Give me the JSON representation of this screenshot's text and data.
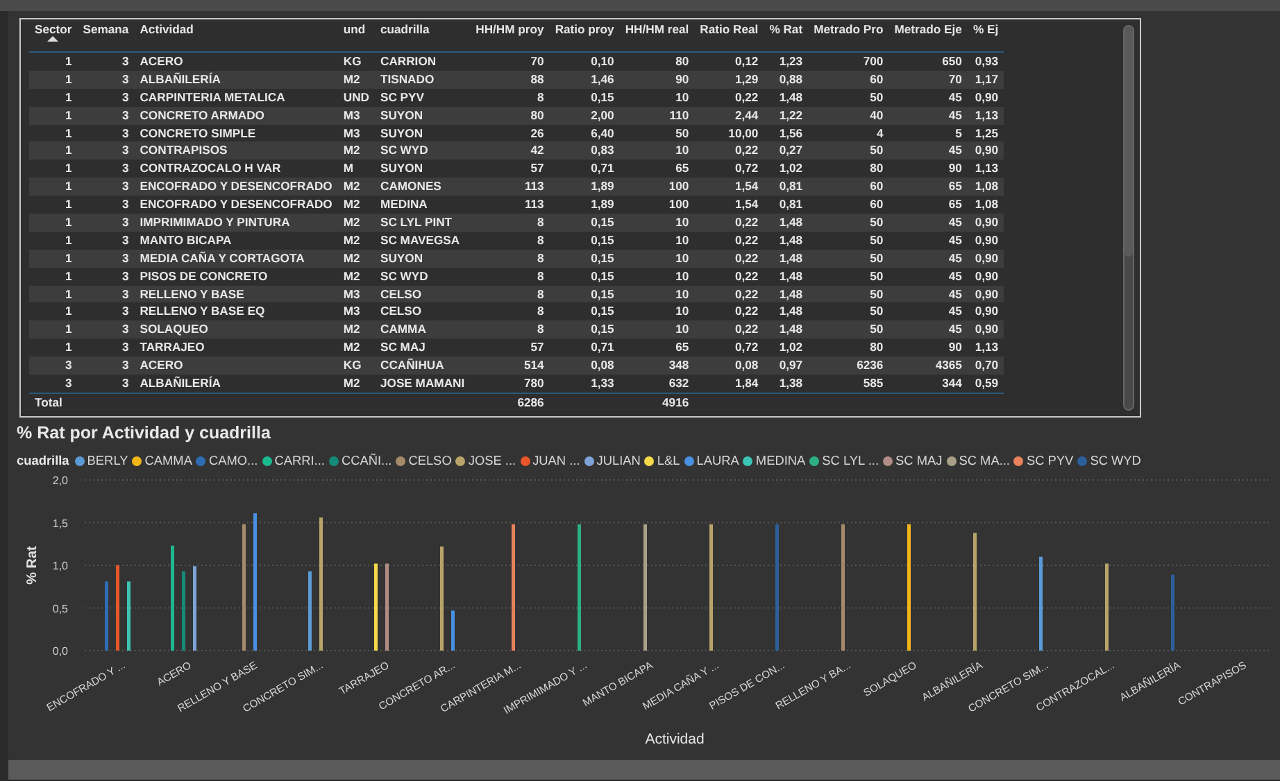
{
  "table": {
    "columns": [
      {
        "label": "Sector",
        "kind": "number",
        "sorted": true
      },
      {
        "label": "Semana",
        "kind": "number",
        "sorted": false
      },
      {
        "label": "Actividad",
        "kind": "text",
        "sorted": false
      },
      {
        "label": "und",
        "kind": "text",
        "sorted": false
      },
      {
        "label": "cuadrilla",
        "kind": "text",
        "sorted": false
      },
      {
        "label": "HH/HM proy",
        "kind": "number",
        "sorted": false
      },
      {
        "label": "Ratio proy",
        "kind": "number",
        "sorted": false
      },
      {
        "label": "HH/HM real",
        "kind": "number",
        "sorted": false
      },
      {
        "label": "Ratio Real",
        "kind": "number",
        "sorted": false
      },
      {
        "label": "% Rat",
        "kind": "number",
        "sorted": false
      },
      {
        "label": "Metrado Pro",
        "kind": "number",
        "sorted": false
      },
      {
        "label": "Metrado Eje",
        "kind": "number",
        "sorted": false
      },
      {
        "label": "% Ej",
        "kind": "number",
        "sorted": false
      }
    ],
    "rows": [
      [
        "1",
        "3",
        "ACERO",
        "KG",
        "CARRION",
        "70",
        "0,10",
        "80",
        "0,12",
        "1,23",
        "700",
        "650",
        "0,93"
      ],
      [
        "1",
        "3",
        "ALBAÑILERÍA",
        "M2",
        "TISNADO",
        "88",
        "1,46",
        "90",
        "1,29",
        "0,88",
        "60",
        "70",
        "1,17"
      ],
      [
        "1",
        "3",
        "CARPINTERIA METALICA",
        "UND",
        "SC PYV",
        "8",
        "0,15",
        "10",
        "0,22",
        "1,48",
        "50",
        "45",
        "0,90"
      ],
      [
        "1",
        "3",
        "CONCRETO ARMADO",
        "M3",
        "SUYON",
        "80",
        "2,00",
        "110",
        "2,44",
        "1,22",
        "40",
        "45",
        "1,13"
      ],
      [
        "1",
        "3",
        "CONCRETO SIMPLE",
        "M3",
        "SUYON",
        "26",
        "6,40",
        "50",
        "10,00",
        "1,56",
        "4",
        "5",
        "1,25"
      ],
      [
        "1",
        "3",
        "CONTRAPISOS",
        "M2",
        "SC WYD",
        "42",
        "0,83",
        "10",
        "0,22",
        "0,27",
        "50",
        "45",
        "0,90"
      ],
      [
        "1",
        "3",
        "CONTRAZOCALO H VAR",
        "M",
        "SUYON",
        "57",
        "0,71",
        "65",
        "0,72",
        "1,02",
        "80",
        "90",
        "1,13"
      ],
      [
        "1",
        "3",
        "ENCOFRADO Y DESENCOFRADO",
        "M2",
        "CAMONES",
        "113",
        "1,89",
        "100",
        "1,54",
        "0,81",
        "60",
        "65",
        "1,08"
      ],
      [
        "1",
        "3",
        "ENCOFRADO Y DESENCOFRADO",
        "M2",
        "MEDINA",
        "113",
        "1,89",
        "100",
        "1,54",
        "0,81",
        "60",
        "65",
        "1,08"
      ],
      [
        "1",
        "3",
        "IMPRIMIMADO Y PINTURA",
        "M2",
        "SC LYL PINT",
        "8",
        "0,15",
        "10",
        "0,22",
        "1,48",
        "50",
        "45",
        "0,90"
      ],
      [
        "1",
        "3",
        "MANTO BICAPA",
        "M2",
        "SC MAVEGSA",
        "8",
        "0,15",
        "10",
        "0,22",
        "1,48",
        "50",
        "45",
        "0,90"
      ],
      [
        "1",
        "3",
        "MEDIA CAÑA Y CORTAGOTA",
        "M2",
        "SUYON",
        "8",
        "0,15",
        "10",
        "0,22",
        "1,48",
        "50",
        "45",
        "0,90"
      ],
      [
        "1",
        "3",
        "PISOS DE CONCRETO",
        "M2",
        "SC WYD",
        "8",
        "0,15",
        "10",
        "0,22",
        "1,48",
        "50",
        "45",
        "0,90"
      ],
      [
        "1",
        "3",
        "RELLENO Y BASE",
        "M3",
        "CELSO",
        "8",
        "0,15",
        "10",
        "0,22",
        "1,48",
        "50",
        "45",
        "0,90"
      ],
      [
        "1",
        "3",
        "RELLENO Y BASE EQ",
        "M3",
        "CELSO",
        "8",
        "0,15",
        "10",
        "0,22",
        "1,48",
        "50",
        "45",
        "0,90"
      ],
      [
        "1",
        "3",
        "SOLAQUEO",
        "M2",
        "CAMMA",
        "8",
        "0,15",
        "10",
        "0,22",
        "1,48",
        "50",
        "45",
        "0,90"
      ],
      [
        "1",
        "3",
        "TARRAJEO",
        "M2",
        "SC MAJ",
        "57",
        "0,71",
        "65",
        "0,72",
        "1,02",
        "80",
        "90",
        "1,13"
      ],
      [
        "3",
        "3",
        "ACERO",
        "KG",
        "CCAÑIHUA",
        "514",
        "0,08",
        "348",
        "0,08",
        "0,97",
        "6236",
        "4365",
        "0,70"
      ],
      [
        "3",
        "3",
        "ALBAÑILERÍA",
        "M2",
        "JOSE MAMANI",
        "780",
        "1,33",
        "632",
        "1,84",
        "1,38",
        "585",
        "344",
        "0,59"
      ]
    ],
    "total": {
      "label": "Total",
      "hh_hm_proy": "6286",
      "hh_hm_real": "4916"
    }
  },
  "chart": {
    "title": "% Rat por Actividad y cuadrilla",
    "legend_title": "cuadrilla",
    "chart_data": {
      "type": "bar",
      "grid": true,
      "xlabel": "Actividad",
      "ylabel": "% Rat",
      "ylim": [
        0,
        2
      ],
      "yticks": [
        {
          "value": 0,
          "label": "0,0"
        },
        {
          "value": 0.5,
          "label": "0,5"
        },
        {
          "value": 1,
          "label": "1,0"
        },
        {
          "value": 1.5,
          "label": "1,5"
        },
        {
          "value": 2,
          "label": "2,0"
        }
      ],
      "categories": [
        "ENCOFRADO Y ...",
        "ACERO",
        "RELLENO Y BASE",
        "CONCRETO SIM...",
        "TARRAJEO",
        "CONCRETO AR...",
        "CARPINTERIA M...",
        "IMPRIMIMADO Y ...",
        "MANTO BICAPA",
        "MEDIA CAÑA Y ...",
        "PISOS DE CON...",
        "RELLENO Y BA...",
        "SOLAQUEO",
        "ALBAÑILERÍA",
        "CONCRETO SIM...",
        "CONTRAZOCAL...",
        "ALBAÑILERÍA",
        "CONTRAPISOS"
      ],
      "series": [
        {
          "name": "BERLY",
          "color": "#5b9bd5",
          "values": [
            null,
            null,
            null,
            0.93,
            null,
            null,
            null,
            null,
            null,
            null,
            null,
            null,
            null,
            null,
            1.1,
            null,
            null,
            null
          ]
        },
        {
          "name": "CAMMA",
          "color": "#f2b619",
          "values": [
            null,
            null,
            null,
            null,
            null,
            null,
            null,
            null,
            null,
            null,
            null,
            null,
            1.48,
            null,
            null,
            null,
            null,
            null
          ]
        },
        {
          "name": "CAMO...",
          "color": "#2e6db4",
          "values": [
            0.81,
            null,
            null,
            null,
            null,
            null,
            null,
            null,
            null,
            null,
            null,
            null,
            null,
            null,
            null,
            null,
            null,
            null
          ]
        },
        {
          "name": "CARRI...",
          "color": "#1bb98e",
          "values": [
            null,
            1.23,
            null,
            null,
            null,
            null,
            null,
            null,
            null,
            null,
            null,
            null,
            null,
            null,
            null,
            null,
            null,
            null
          ]
        },
        {
          "name": "CCAÑI...",
          "color": "#168a78",
          "values": [
            null,
            0.93,
            null,
            null,
            null,
            null,
            null,
            null,
            null,
            null,
            null,
            null,
            null,
            null,
            null,
            null,
            null,
            null
          ]
        },
        {
          "name": "CELSO",
          "color": "#a58a6a",
          "values": [
            null,
            null,
            1.48,
            null,
            null,
            null,
            null,
            null,
            null,
            null,
            null,
            1.48,
            null,
            null,
            null,
            null,
            null,
            null
          ]
        },
        {
          "name": "JOSE ...",
          "color": "#b8a46a",
          "values": [
            null,
            null,
            null,
            1.56,
            null,
            1.22,
            null,
            null,
            null,
            1.48,
            null,
            null,
            null,
            1.38,
            null,
            1.02,
            null,
            null
          ]
        },
        {
          "name": "JUAN ...",
          "color": "#e8562a",
          "values": [
            1.0,
            null,
            null,
            null,
            null,
            null,
            null,
            null,
            null,
            null,
            null,
            null,
            null,
            null,
            null,
            null,
            null,
            null
          ]
        },
        {
          "name": "JULIAN",
          "color": "#7ea3d8",
          "values": [
            null,
            0.99,
            null,
            null,
            null,
            null,
            null,
            null,
            null,
            null,
            null,
            null,
            null,
            null,
            null,
            null,
            null,
            null
          ]
        },
        {
          "name": "L&L",
          "color": "#f5d94a",
          "values": [
            null,
            null,
            null,
            null,
            1.02,
            null,
            null,
            null,
            null,
            null,
            null,
            null,
            null,
            null,
            null,
            null,
            null,
            null
          ]
        },
        {
          "name": "LAURA",
          "color": "#4a90e2",
          "values": [
            null,
            null,
            1.61,
            null,
            null,
            0.47,
            null,
            null,
            null,
            null,
            null,
            null,
            null,
            null,
            null,
            null,
            null,
            null
          ]
        },
        {
          "name": "MEDINA",
          "color": "#3cc5b5",
          "values": [
            0.81,
            null,
            null,
            null,
            null,
            null,
            null,
            null,
            null,
            null,
            null,
            null,
            null,
            null,
            null,
            null,
            null,
            null
          ]
        },
        {
          "name": "SC LYL ...",
          "color": "#2bb083",
          "values": [
            null,
            null,
            null,
            null,
            null,
            null,
            null,
            1.48,
            null,
            null,
            null,
            null,
            null,
            null,
            null,
            null,
            null,
            null
          ]
        },
        {
          "name": "SC MAJ",
          "color": "#b08c84",
          "values": [
            null,
            null,
            null,
            null,
            1.02,
            null,
            null,
            null,
            null,
            null,
            null,
            null,
            null,
            null,
            null,
            null,
            null,
            null
          ]
        },
        {
          "name": "SC MA...",
          "color": "#a9a087",
          "values": [
            null,
            null,
            null,
            null,
            null,
            null,
            null,
            null,
            1.48,
            null,
            null,
            null,
            null,
            null,
            null,
            null,
            null,
            null
          ]
        },
        {
          "name": "SC PYV",
          "color": "#e8825a",
          "values": [
            null,
            null,
            null,
            null,
            null,
            null,
            1.48,
            null,
            null,
            null,
            null,
            null,
            null,
            null,
            null,
            null,
            null,
            null
          ]
        },
        {
          "name": "SC WYD",
          "color": "#2d5f9a",
          "values": [
            null,
            null,
            null,
            null,
            null,
            null,
            null,
            null,
            null,
            null,
            1.48,
            null,
            null,
            null,
            null,
            null,
            0.89,
            null
          ]
        }
      ]
    }
  }
}
